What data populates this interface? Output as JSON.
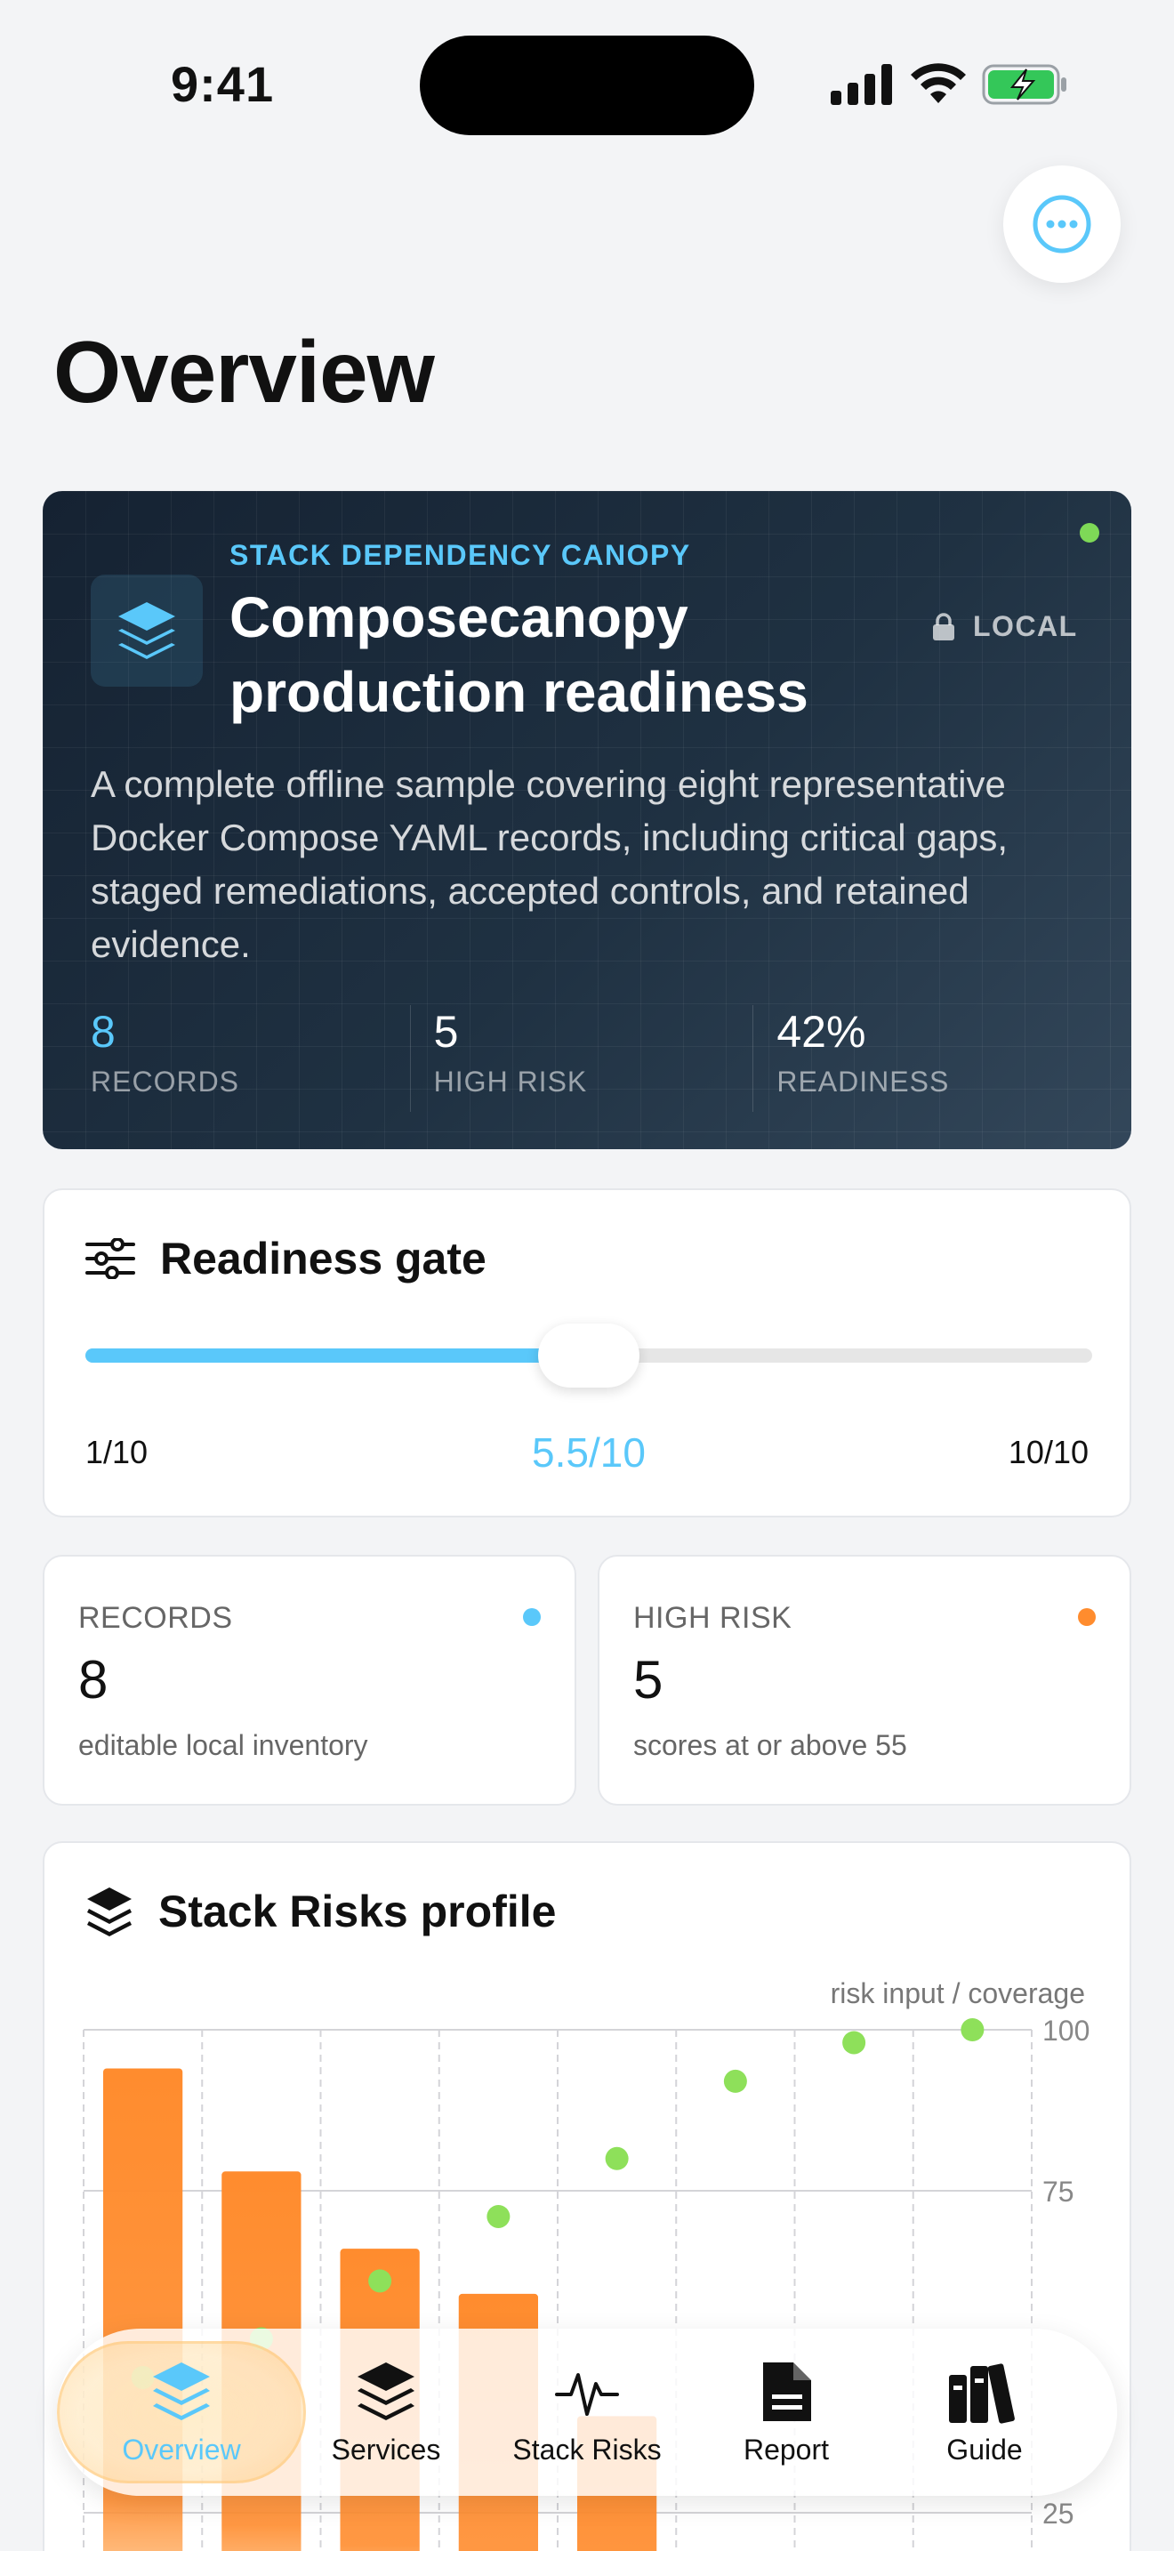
{
  "status_bar": {
    "time": "9:41"
  },
  "page": {
    "title": "Overview"
  },
  "hero": {
    "eyebrow": "STACK DEPENDENCY CANOPY",
    "title": "Composecanopy production readiness",
    "badge": "LOCAL",
    "description": "A complete offline sample covering eight representative Docker Compose YAML records, including critical gaps, staged remediations, accepted controls, and retained evidence.",
    "stats": [
      {
        "value": "8",
        "label": "RECORDS"
      },
      {
        "value": "5",
        "label": "HIGH RISK"
      },
      {
        "value": "42%",
        "label": "READINESS"
      }
    ]
  },
  "gate": {
    "title": "Readiness gate",
    "min_label": "1/10",
    "value_label": "5.5/10",
    "max_label": "10/10",
    "value": 5.5,
    "min": 1,
    "max": 10
  },
  "metrics": [
    {
      "label": "RECORDS",
      "value": "8",
      "sub": "editable local inventory",
      "color": "#5ac8fa"
    },
    {
      "label": "HIGH RISK",
      "value": "5",
      "sub": "scores at or above 55",
      "color": "#ff8c2e"
    }
  ],
  "profile": {
    "title": "Stack Risks profile"
  },
  "chart_data": {
    "type": "bar",
    "title": "",
    "legend_label": "risk input / coverage",
    "ylim": [
      0,
      100
    ],
    "yticks": [
      "100",
      "75",
      "25"
    ],
    "bar_values": [
      94,
      78,
      66,
      59,
      40,
      5,
      0,
      0
    ],
    "coverage_values": [
      46,
      52,
      61,
      71,
      80,
      92,
      98,
      100
    ],
    "bar_color": "#ff8c2e",
    "point_color": "#8ee05a"
  },
  "tabs": [
    {
      "label": "Overview",
      "icon": "layers-icon",
      "active": true
    },
    {
      "label": "Services",
      "icon": "stack-icon",
      "active": false
    },
    {
      "label": "Stack Risks",
      "icon": "pulse-icon",
      "active": false
    },
    {
      "label": "Report",
      "icon": "document-icon",
      "active": false
    },
    {
      "label": "Guide",
      "icon": "books-icon",
      "active": false
    }
  ],
  "colors": {
    "accent": "#5ac8fa",
    "warning": "#ff8c2e",
    "ok": "#7ed957"
  }
}
